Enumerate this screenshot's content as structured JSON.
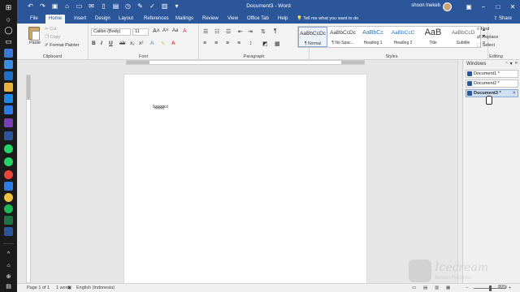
{
  "taskbar": {
    "icons": [
      "windows-start-icon",
      "search-icon",
      "cortana-icon",
      "task-view-icon",
      "edge-icon",
      "store-icon",
      "explorer-icon",
      "photoshop-icon",
      "mail-icon",
      "onenote-icon",
      "word-icon",
      "whatsapp-icon",
      "chrome-icon",
      "spotify-icon",
      "excel-icon",
      "app-icon",
      "app-icon",
      "network-icon",
      "language-icon",
      "notification-icon"
    ]
  },
  "titlebar": {
    "title": "Document3 - Word",
    "user": "shoon lnekeb",
    "qat": [
      "save-icon",
      "undo-icon",
      "redo-icon",
      "touch-icon",
      "email-icon",
      "print-icon",
      "new-icon",
      "open-icon",
      "spelling-icon",
      "customize-icon"
    ]
  },
  "tabs": [
    "File",
    "Home",
    "Insert",
    "Design",
    "Layout",
    "References",
    "Mailings",
    "Review",
    "View",
    "Office Tab",
    "Help"
  ],
  "active_tab": "Home",
  "tell_me": "Tell me what you want to do",
  "share": "Share",
  "ribbon": {
    "clipboard": {
      "label": "Clipboard",
      "paste": "Paste",
      "cut": "Cut",
      "copy": "Copy",
      "format_painter": "Format Painter"
    },
    "font": {
      "label": "Font",
      "font_name": "Calibri (Body)",
      "font_size": "11"
    },
    "paragraph": {
      "label": "Paragraph"
    },
    "styles": {
      "label": "Styles",
      "items": [
        {
          "sample": "AaBbCcDc",
          "name": "¶ Normal"
        },
        {
          "sample": "AaBbCcDc",
          "name": "¶ No Spac..."
        },
        {
          "sample": "AaBbCc",
          "name": "Heading 1"
        },
        {
          "sample": "AaBbCcC",
          "name": "Heading 2"
        },
        {
          "sample": "AaB",
          "name": "Title"
        },
        {
          "sample": "AaBbCcD",
          "name": "Subtitle"
        }
      ]
    },
    "editing": {
      "label": "Editing",
      "find": "Find",
      "replace": "Replace",
      "select": "Select"
    }
  },
  "document": {
    "text": "fggggcc"
  },
  "windows_pane": {
    "title": "Windows",
    "documents": [
      {
        "name": "Document1 *"
      },
      {
        "name": "Document2 *"
      },
      {
        "name": "Document3 *"
      }
    ]
  },
  "statusbar": {
    "page": "Page 1 of 1",
    "words": "1 word",
    "language": "English (Indonesia)",
    "zoom": "80%"
  },
  "watermark": {
    "line1": "Icecream",
    "line2": "Screen Recorder"
  }
}
